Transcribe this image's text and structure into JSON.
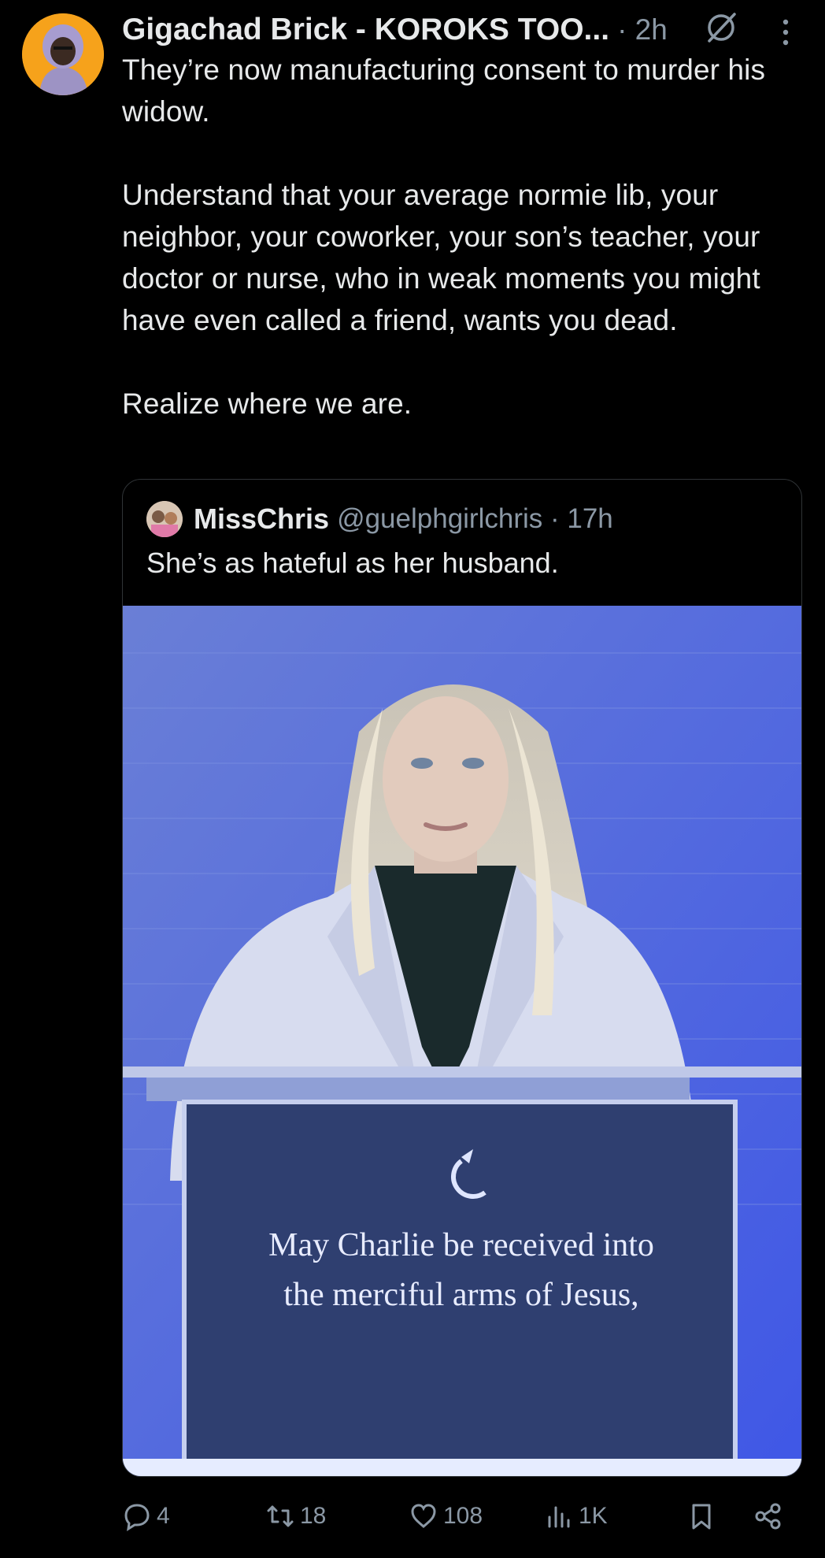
{
  "post": {
    "author_name": "Gigachad Brick - KOROKS TOO...",
    "time": "· 2h",
    "text": "They’re now manufacturing consent to murder his widow.\n\nUnderstand that your average normie lib, your neighbor, your coworker, your son’s teacher, your doctor or nurse, who in weak moments you might have even called a friend, wants you dead.\n\nRealize where we are."
  },
  "quote": {
    "author_name": "MissChris",
    "handle_time": "@guelphgirlchris · 17h",
    "text": "She’s as hateful as her husband.",
    "media": {
      "podium_line1": "May Charlie be received into",
      "podium_line2": "the merciful arms of Jesus,"
    }
  },
  "actions": {
    "replies": "4",
    "reposts": "18",
    "likes": "108",
    "views": "1K"
  },
  "icons": [
    "grok-icon",
    "more-icon",
    "reply-icon",
    "repost-icon",
    "like-icon",
    "views-icon",
    "bookmark-icon",
    "share-icon"
  ],
  "colors": {
    "background": "#000000",
    "text": "#e7e9ea",
    "muted": "#8b98a5",
    "avatar_bg": "#f6a21b"
  }
}
